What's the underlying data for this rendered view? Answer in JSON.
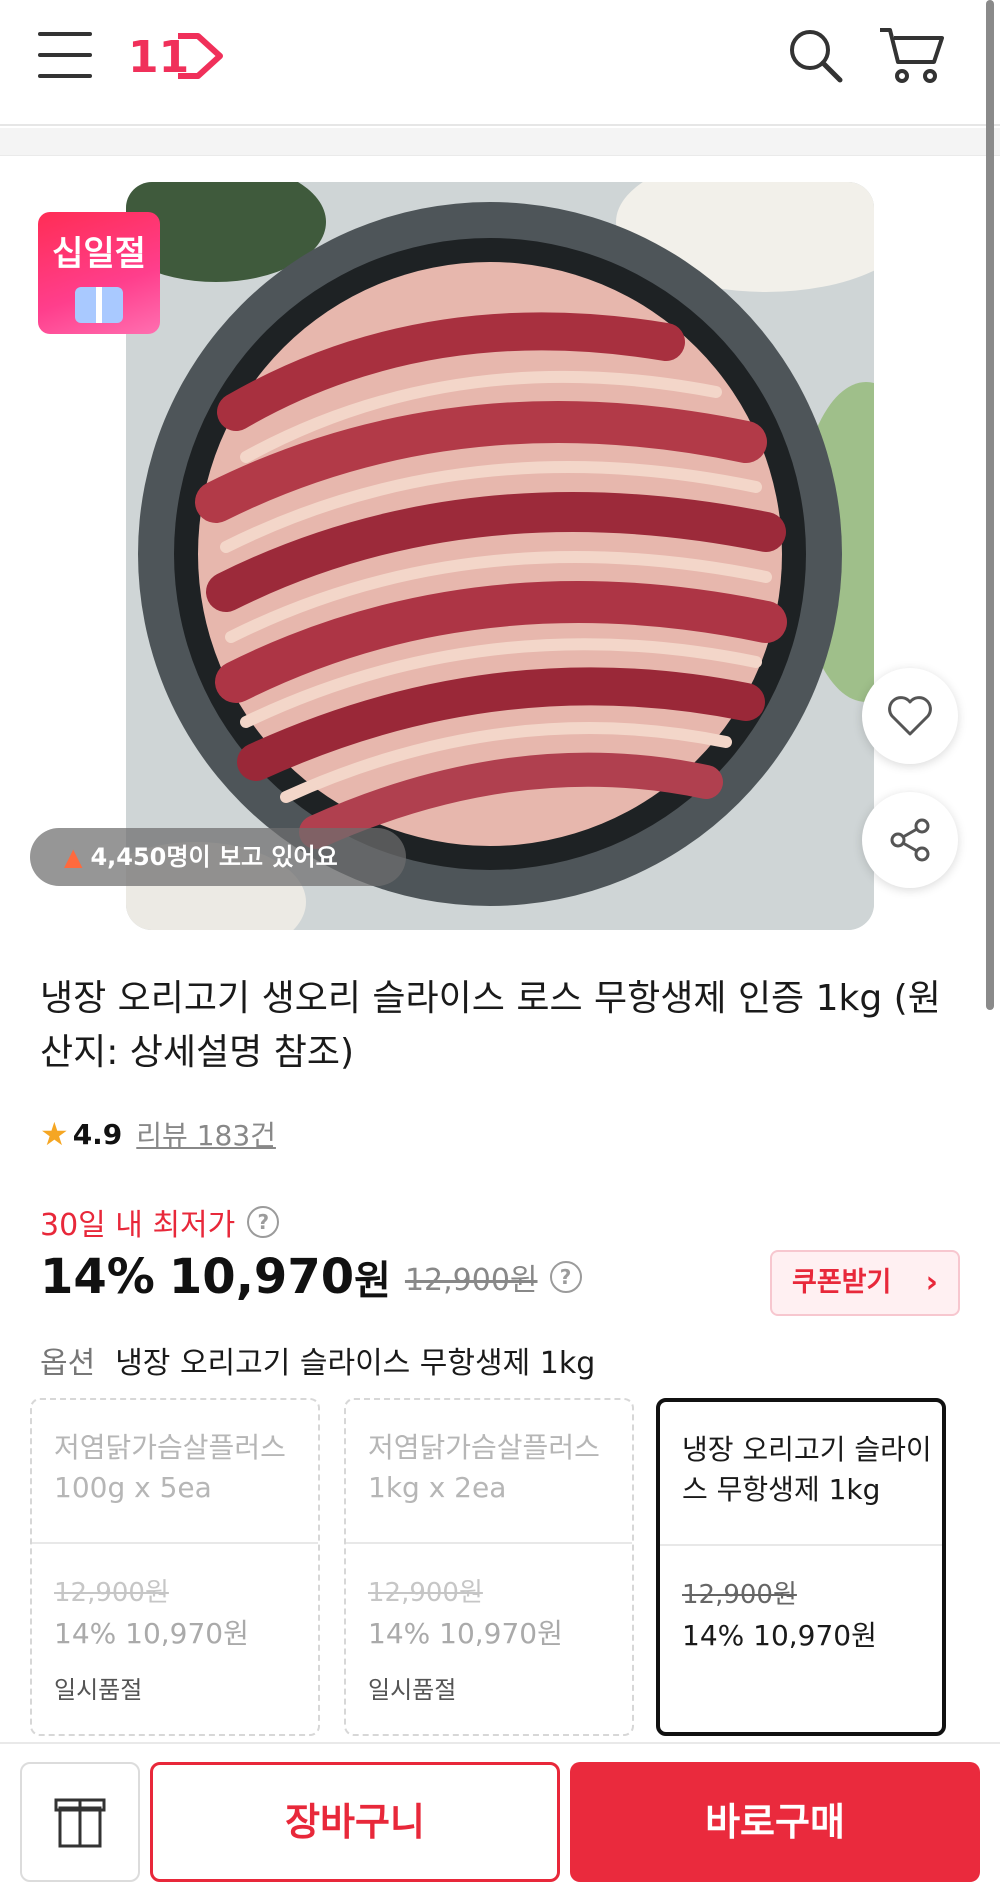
{
  "header": {
    "logo_text": "11",
    "brand_color": "#f0305a"
  },
  "product": {
    "badge_text": "십일절",
    "viewers_text": "4,450명이 보고 있어요",
    "title": "냉장 오리고기 생오리 슬라이스 로스 무항생제 인증 1kg (원산지: 상세설명 참조)",
    "rating": "4.9",
    "reviews_label": "리뷰 183건"
  },
  "price": {
    "lowest_label": "30일 내 최저가",
    "help_icon": "?",
    "discount": "14%",
    "sale_price": "10,970",
    "sale_unit": "원",
    "original_price": "12,900원",
    "coupon_label": "쿠폰받기",
    "accent_color": "#e8283a"
  },
  "option": {
    "label": "옵션",
    "selected_value": "냉장 오리고기 슬라이스 무항생제 1kg",
    "cards": [
      {
        "name": "저염닭가슴살플러스 100g x 5ea",
        "orig": "12,900원",
        "price": "14% 10,970원",
        "status": "일시품절"
      },
      {
        "name": "저염닭가슴살플러스 1kg x 2ea",
        "orig": "12,900원",
        "price": "14% 10,970원",
        "status": "일시품절"
      },
      {
        "name": "냉장 오리고기 슬라이스 무항생제 1kg",
        "orig": "12,900원",
        "price": "14% 10,970원",
        "status": ""
      }
    ]
  },
  "bottom": {
    "cart_label": "장바구니",
    "buy_label": "바로구매"
  },
  "icons": {
    "menu": "hamburger-icon",
    "search": "search-icon",
    "cart": "cart-icon",
    "wish": "heart-icon",
    "share": "share-icon",
    "gift": "gift-icon",
    "fire": "fire-icon"
  }
}
